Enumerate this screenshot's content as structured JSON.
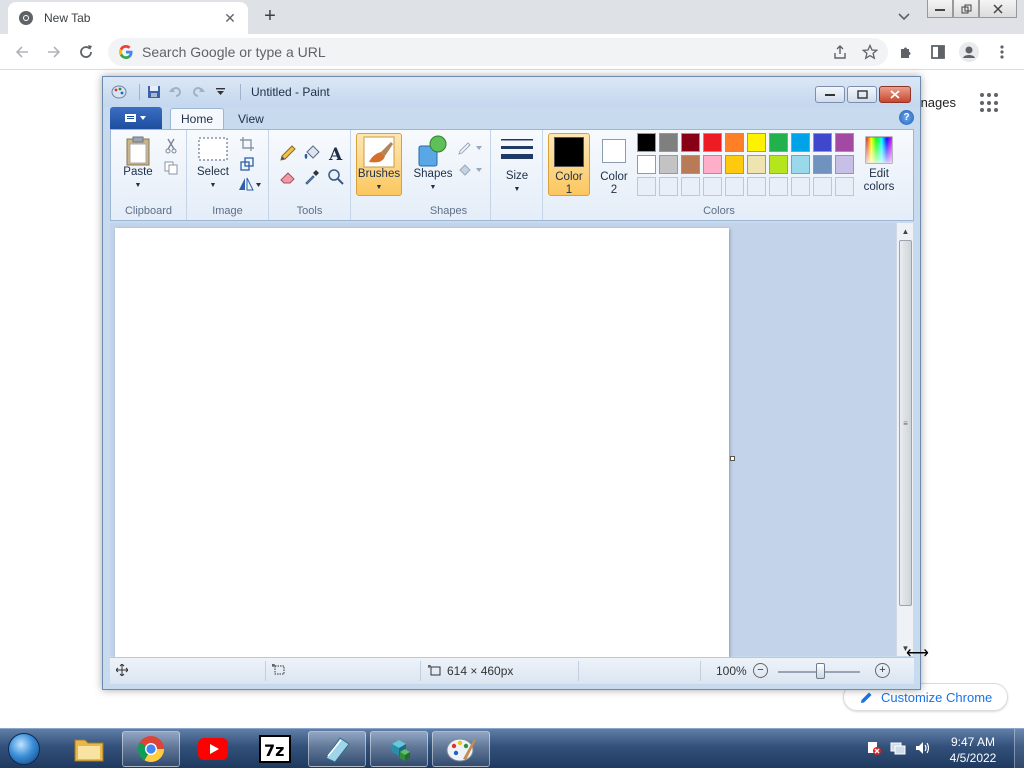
{
  "chrome": {
    "tab_title": "New Tab",
    "tab_close": "✕",
    "new_tab": "+",
    "omnibox_placeholder": "Search Google or type a URL",
    "ntp_images_link": "nages",
    "customize_label": "Customize Chrome"
  },
  "paint": {
    "window_title": "Untitled - Paint",
    "tabs": {
      "home": "Home",
      "view": "View"
    },
    "help": "?",
    "groups": {
      "clipboard": "Clipboard",
      "image": "Image",
      "tools": "Tools",
      "shapes": "Shapes",
      "colors": "Colors"
    },
    "buttons": {
      "paste": "Paste",
      "select": "Select",
      "brushes": "Brushes",
      "shapes": "Shapes",
      "size": "Size",
      "color1_line1": "Color",
      "color1_line2": "1",
      "color2_line1": "Color",
      "color2_line2": "2",
      "edit_colors_line1": "Edit",
      "edit_colors_line2": "colors"
    },
    "color1_value": "#000000",
    "color2_value": "#ffffff",
    "palette_row1": [
      "#000000",
      "#7f7f7f",
      "#880015",
      "#ed1c24",
      "#ff7f27",
      "#fff200",
      "#22b14c",
      "#00a2e8",
      "#3f48cc",
      "#a349a4"
    ],
    "palette_row2": [
      "#ffffff",
      "#c3c3c3",
      "#b97a57",
      "#ffaec9",
      "#ffc90e",
      "#efe4b0",
      "#b5e61d",
      "#99d9ea",
      "#7092be",
      "#c8bfe7"
    ],
    "status": {
      "dimensions": "614 × 460px",
      "zoom": "100%"
    }
  },
  "taskbar": {
    "clock_time": "9:47 AM",
    "clock_date": "4/5/2022",
    "apps": [
      "windows-explorer",
      "chrome",
      "youtube",
      "7-zip",
      "notepad",
      "app-cubes",
      "paint"
    ]
  }
}
